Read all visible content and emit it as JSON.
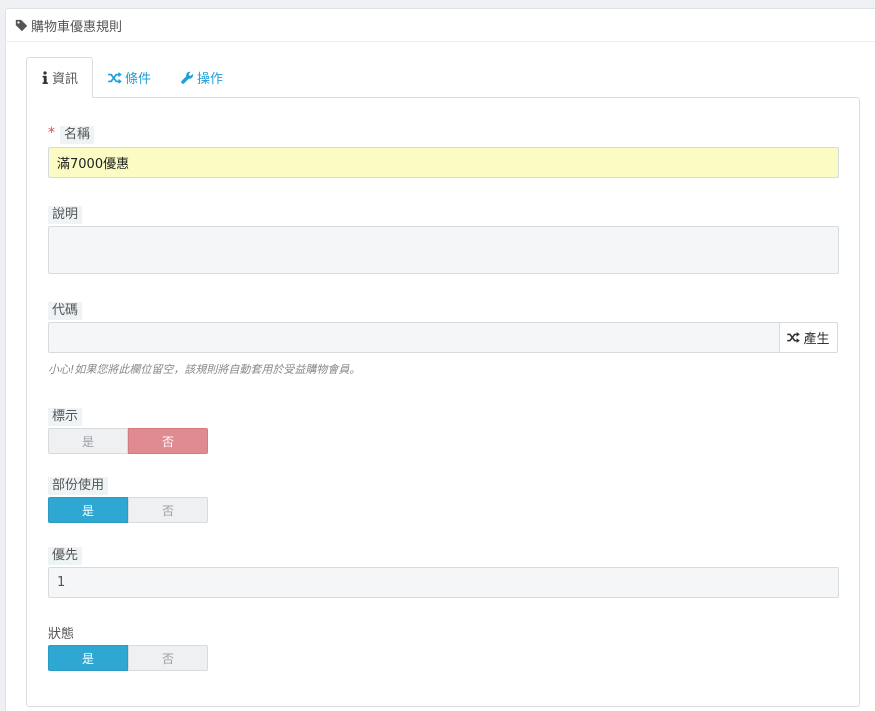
{
  "panel": {
    "title": "購物車優惠規則",
    "icon": "tag-icon"
  },
  "tabs": [
    {
      "label": "資訊",
      "icon": "info-icon",
      "active": true
    },
    {
      "label": "條件",
      "icon": "shuffle-icon",
      "active": false
    },
    {
      "label": "操作",
      "icon": "wrench-icon",
      "active": false
    }
  ],
  "form": {
    "name": {
      "label": "名稱",
      "required_mark": "*",
      "value": "滿7000優惠"
    },
    "description": {
      "label": "說明",
      "value": ""
    },
    "code": {
      "label": "代碼",
      "value": "",
      "generate_button": "產生",
      "help": "小心!如果您將此欄位留空，該規則將自動套用於受益購物會員。"
    },
    "highlight": {
      "label": "標示",
      "yes": "是",
      "no": "否",
      "selected": "no"
    },
    "partial_use": {
      "label": "部份使用",
      "yes": "是",
      "no": "否",
      "selected": "yes"
    },
    "priority": {
      "label": "優先",
      "value": "1"
    },
    "status": {
      "label": "狀態",
      "yes": "是",
      "no": "否",
      "selected": "yes"
    }
  },
  "colors": {
    "accent": "#1e9fd8",
    "switch_on": "#2ea8d3",
    "switch_on_danger": "#e08b91",
    "required": "#e04b4a",
    "highlight_input": "#fbfcc3"
  }
}
